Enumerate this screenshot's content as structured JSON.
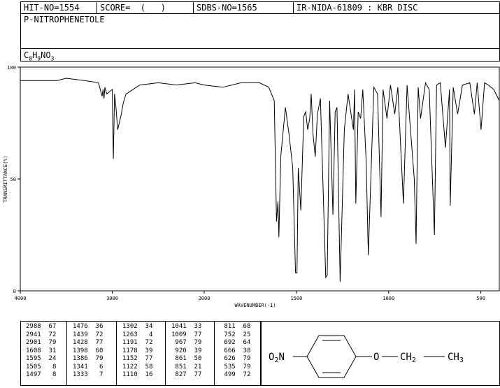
{
  "header": {
    "hit_no": "HIT-NO=1554",
    "score": "SCORE=  (   )",
    "sdbs_no": "SDBS-NO=1565",
    "ir_nida": "IR-NIDA-61809 : KBR DISC"
  },
  "compound": {
    "name": "P-NITROPHENETOLE",
    "formula": "C8H9NO3"
  },
  "chart_data": {
    "type": "line",
    "xlabel": "WAVENUMBER(-1)",
    "ylabel": "TRANSMITTANCE(%)",
    "xlim": [
      4000,
      400
    ],
    "ylim": [
      0,
      100
    ],
    "x_ticks": [
      "4000",
      "3000",
      "2000",
      "1500",
      "1000",
      "500"
    ],
    "y_ticks": [
      "100",
      "50",
      "0"
    ],
    "series": [
      {
        "x": [
          4000,
          3800,
          3600,
          3500,
          3300,
          3150,
          3110,
          3100,
          3090,
          3080,
          3060,
          3000,
          2988,
          2975,
          2960,
          2941,
          2901,
          2880,
          2850,
          2700,
          2500,
          2300,
          2100,
          2000,
          1900,
          1800,
          1700,
          1650,
          1620,
          1608,
          1600,
          1595,
          1585,
          1560,
          1540,
          1520,
          1505,
          1497,
          1490,
          1476,
          1460,
          1450,
          1439,
          1428,
          1420,
          1410,
          1398,
          1386,
          1370,
          1341,
          1333,
          1320,
          1302,
          1290,
          1280,
          1263,
          1240,
          1220,
          1191,
          1185,
          1178,
          1165,
          1152,
          1140,
          1122,
          1110,
          1080,
          1060,
          1041,
          1030,
          1009,
          990,
          967,
          950,
          920,
          900,
          861,
          851,
          840,
          827,
          800,
          780,
          752,
          740,
          720,
          692,
          670,
          666,
          650,
          626,
          600,
          560,
          535,
          520,
          499,
          480,
          460,
          430,
          400
        ],
        "y": [
          94,
          94,
          94,
          95,
          94,
          93,
          87,
          90,
          86,
          91,
          88,
          90,
          59,
          88,
          82,
          72,
          79,
          84,
          88,
          92,
          93,
          92,
          93,
          92,
          91,
          93,
          93,
          91,
          85,
          31,
          40,
          24,
          60,
          82,
          70,
          55,
          8,
          8,
          55,
          36,
          78,
          80,
          72,
          77,
          88,
          70,
          60,
          79,
          86,
          6,
          7,
          85,
          34,
          80,
          82,
          4,
          72,
          88,
          72,
          90,
          39,
          80,
          77,
          90,
          58,
          16,
          91,
          88,
          33,
          90,
          77,
          92,
          79,
          91,
          39,
          92,
          50,
          21,
          91,
          77,
          93,
          90,
          25,
          92,
          93,
          64,
          90,
          38,
          91,
          79,
          92,
          93,
          79,
          93,
          72,
          93,
          92,
          90,
          85
        ]
      }
    ]
  },
  "peaks": [
    [
      "2988",
      "67"
    ],
    [
      "2941",
      "72"
    ],
    [
      "2901",
      "79"
    ],
    [
      "1608",
      "31"
    ],
    [
      "1595",
      "24"
    ],
    [
      "1505",
      "8"
    ],
    [
      "1497",
      "8"
    ],
    [
      "1476",
      "36"
    ],
    [
      "1439",
      "72"
    ],
    [
      "1428",
      "77"
    ],
    [
      "1398",
      "60"
    ],
    [
      "1386",
      "79"
    ],
    [
      "1341",
      "6"
    ],
    [
      "1333",
      "7"
    ],
    [
      "1302",
      "34"
    ],
    [
      "1263",
      "4"
    ],
    [
      "1191",
      "72"
    ],
    [
      "1178",
      "39"
    ],
    [
      "1152",
      "77"
    ],
    [
      "1122",
      "58"
    ],
    [
      "1110",
      "16"
    ],
    [
      "1041",
      "33"
    ],
    [
      "1009",
      "77"
    ],
    [
      "967",
      "79"
    ],
    [
      "920",
      "39"
    ],
    [
      "861",
      "50"
    ],
    [
      "851",
      "21"
    ],
    [
      "827",
      "77"
    ],
    [
      "811",
      "68"
    ],
    [
      "752",
      "25"
    ],
    [
      "692",
      "64"
    ],
    [
      "666",
      "38"
    ],
    [
      "626",
      "79"
    ],
    [
      "535",
      "79"
    ],
    [
      "499",
      "72"
    ]
  ],
  "structure": {
    "nitro": "O2N",
    "oxygen": "O",
    "ch2": "CH2",
    "ch3": "CH3"
  }
}
